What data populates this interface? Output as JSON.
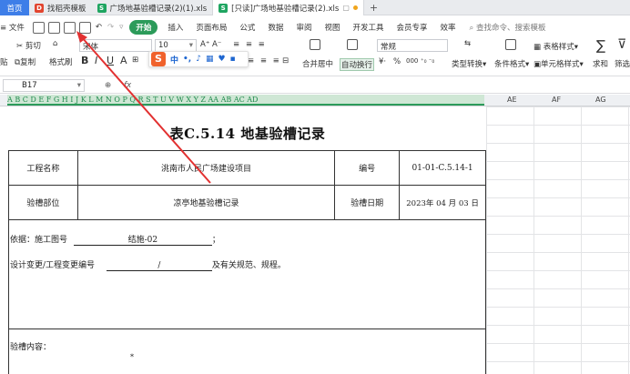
{
  "tabs": [
    {
      "label": "首页",
      "type": "home"
    },
    {
      "label": "找稻壳模板",
      "icon": "docer-icon"
    },
    {
      "label": "广场地基验槽记录(2)(1).xls",
      "icon": "sheet-icon"
    },
    {
      "label": "[只读]广场地基验槽记录(2).xls",
      "icon": "sheet-icon",
      "active": true
    }
  ],
  "menu": {
    "file": "文件",
    "start": "开始",
    "items": [
      "插入",
      "页面布局",
      "公式",
      "数据",
      "审阅",
      "视图",
      "开发工具",
      "会员专享",
      "效率"
    ],
    "search_placeholder": "查找命令、搜索模板"
  },
  "ribbon": {
    "cut": "剪切",
    "copy": "复制",
    "format_painter": "格式刷",
    "paste": "贴",
    "font_name": "宋体",
    "font_size": "10",
    "merge_center": "合并居中",
    "wrap_text": "自动换行",
    "number_format": "常规",
    "type_convert": "类型转换",
    "conditional_format": "条件格式",
    "table_style": "表格样式",
    "cell_style": "单元格样式",
    "sum": "求和",
    "filter": "筛选",
    "currency": "¥",
    "percent": "%",
    "thousands": "000"
  },
  "ime": {
    "logo": "S",
    "mode": "中"
  },
  "formula_bar": {
    "cell_ref": "B17",
    "fx": "fx",
    "zoom_icon": "zoom-icon"
  },
  "columns": {
    "selected": "A  B  C  D  E  F  G  H  I  J  K  L  M  N  O  P  Q  R  S  T  U  V  W  X  Y  Z  AA  AB  AC  AD",
    "rest": [
      "AE",
      "AF",
      "AG"
    ]
  },
  "document": {
    "title": "表C.5.14 地基验槽记录",
    "project_label": "工程名称",
    "project_value": "洮南市人民广场建设项目",
    "number_label": "编号",
    "number_value": "01-01-C.5.14-1",
    "part_label": "验槽部位",
    "part_value": "凉亭地基验槽记录",
    "date_label": "验槽日期",
    "date_value": "2023年 04 月 03 日",
    "basis_prefix": "依据：施工图号",
    "basis_value": "结施-02",
    "basis_suffix": "；",
    "change_prefix": "设计变更/工程变更编号",
    "change_value": "/",
    "change_suffix": "及有关规范、规程。",
    "content_label": "验槽内容：",
    "content_mark": "*"
  },
  "colors": {
    "accent": "#2c9b5a",
    "arrow": "#e23030",
    "home_tab": "#3e7ee8"
  }
}
